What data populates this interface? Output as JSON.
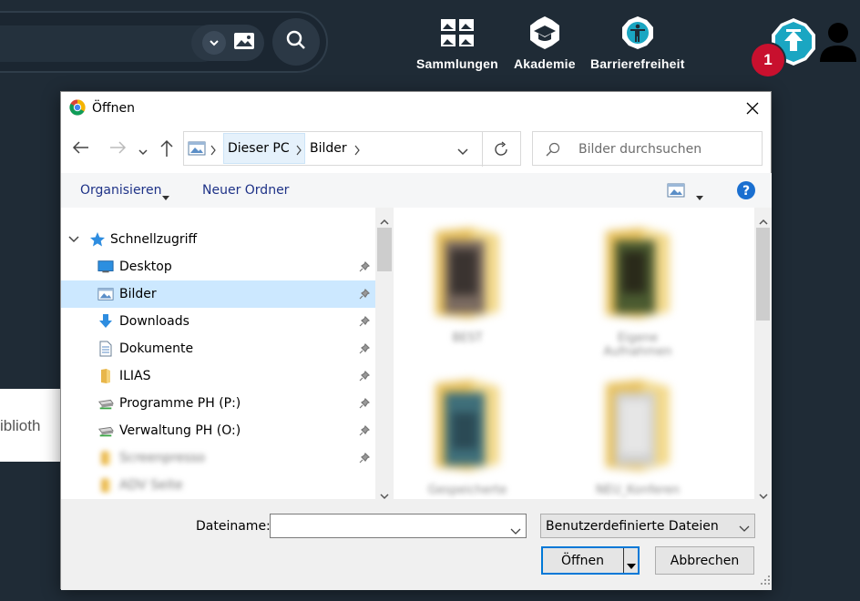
{
  "app": {
    "nav": {
      "collections": "Sammlungen",
      "academy": "Akademie",
      "accessibility": "Barrierefreiheit"
    },
    "upload_badge_count": "1",
    "side_card_text": "iblioth",
    "colors": {
      "background": "#1f2b36",
      "accent": "#1aa6c2",
      "badge": "#c8102e"
    }
  },
  "dialog": {
    "title": "Öffnen",
    "address": {
      "crumbs": [
        "Dieser PC",
        "Bilder"
      ]
    },
    "search_placeholder": "Bilder durchsuchen",
    "toolbar": {
      "organize": "Organisieren",
      "new_folder": "Neuer Ordner"
    },
    "nav_pane": {
      "quick_access": "Schnellzugriff",
      "items": [
        {
          "label": "Desktop",
          "icon": "desktop-icon",
          "pinned": true,
          "selected": false
        },
        {
          "label": "Bilder",
          "icon": "pictures-icon",
          "pinned": true,
          "selected": true
        },
        {
          "label": "Downloads",
          "icon": "download-icon",
          "pinned": true,
          "selected": false
        },
        {
          "label": "Dokumente",
          "icon": "documents-icon",
          "pinned": true,
          "selected": false
        },
        {
          "label": "ILIAS",
          "icon": "folder-icon",
          "pinned": true,
          "selected": false
        },
        {
          "label": "Programme PH (P:)",
          "icon": "network-drive-icon",
          "pinned": true,
          "selected": false
        },
        {
          "label": "Verwaltung PH (O:)",
          "icon": "network-drive-icon",
          "pinned": true,
          "selected": false
        },
        {
          "label": "Screenpresso",
          "icon": "folder-icon",
          "pinned": true,
          "selected": false,
          "blurred": true
        },
        {
          "label": "ADV Seite",
          "icon": "folder-icon",
          "pinned": false,
          "selected": false,
          "blurred": true
        }
      ]
    },
    "files": [
      {
        "name": "BEST",
        "blurred": true
      },
      {
        "name": "Eigene Aufnahmen",
        "blurred": true
      },
      {
        "name": "Gespeicherte",
        "blurred": true
      },
      {
        "name": "NEU_Konferen",
        "blurred": true
      }
    ],
    "filename_label": "Dateiname:",
    "filename_value": "",
    "filetype_value": "Benutzerdefinierte Dateien",
    "open_label": "Öffnen",
    "cancel_label": "Abbrechen"
  }
}
